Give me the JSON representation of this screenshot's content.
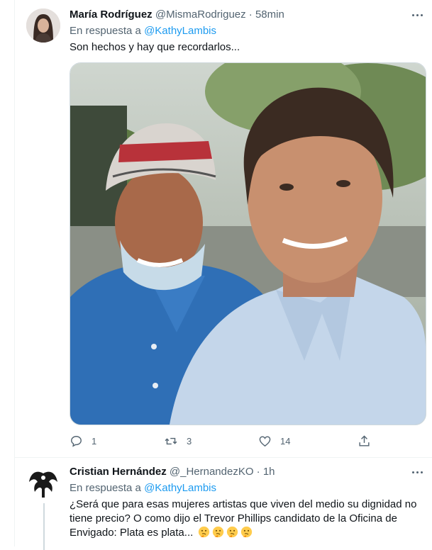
{
  "tweets": [
    {
      "author_name": "María Rodríguez",
      "handle": "@MismaRodriguez",
      "separator": "·",
      "time": "58min",
      "reply_prefix": "En respuesta a",
      "reply_to": "@KathyLambis",
      "text": "Son hechos y hay que recordarlos...",
      "avatar": "woman-portrait-avatar",
      "media": "photo-two-men-smiling-selfie",
      "actions": [
        {
          "icon": "reply-icon",
          "count": "1"
        },
        {
          "icon": "retweet-icon",
          "count": "3"
        },
        {
          "icon": "like-icon",
          "count": "14"
        },
        {
          "icon": "share-icon",
          "count": ""
        }
      ]
    },
    {
      "author_name": "Cristian Hernández",
      "handle": "@_HernandezKO",
      "separator": "·",
      "time": "1h",
      "reply_prefix": "En respuesta a",
      "reply_to": "@KathyLambis",
      "text": "¿Será que para esas mujeres artistas que viven del medio su dignidad no tiene precio? O como dijo el Trevor Phillips candidato de la Oficina de Envigado: Plata es plata...",
      "emojis": [
        "thinking-face",
        "thinking-face",
        "thinking-face",
        "thinking-face"
      ],
      "avatar": "winged-figure-avatar"
    }
  ],
  "colors": {
    "text": "#0f1419",
    "muted": "#536471",
    "link": "#1d9bf0",
    "border": "#eff3f4"
  }
}
